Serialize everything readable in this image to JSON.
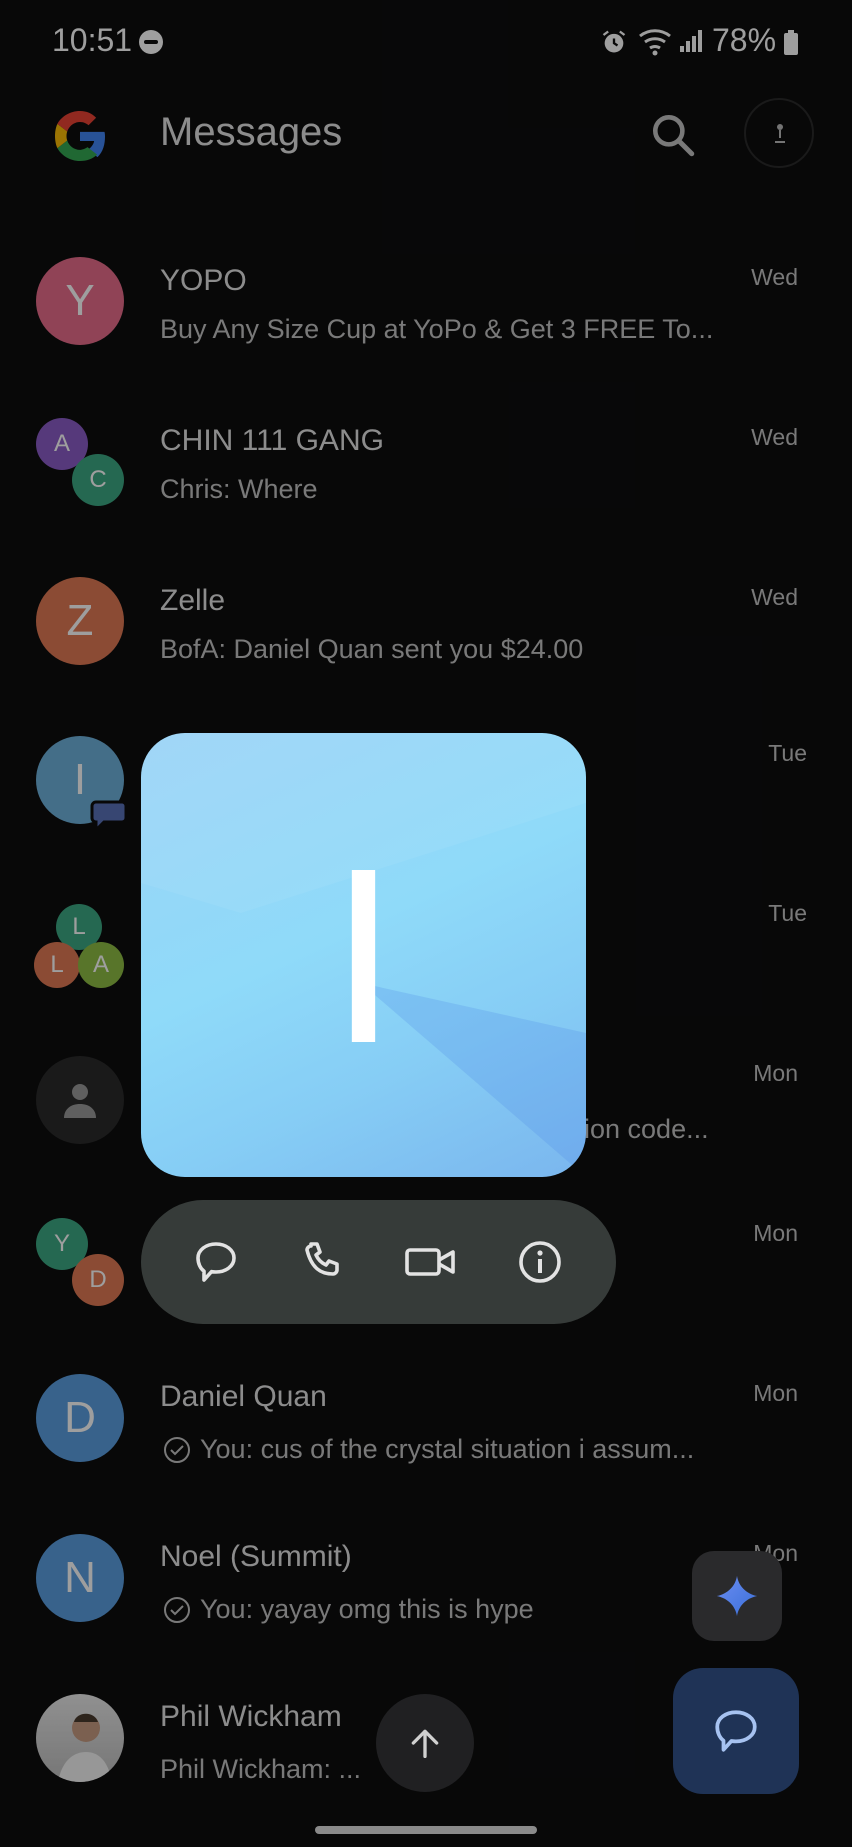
{
  "status_bar": {
    "time": "10:51",
    "battery": "78%"
  },
  "app_bar": {
    "title": "Messages"
  },
  "conversations": [
    {
      "initial": "Y",
      "name": "YOPO",
      "snippet": "Buy Any Size Cup at YoPo & Get 3 FREE To...",
      "date": "Wed",
      "color": "#e86d8c"
    },
    {
      "initials": [
        "A",
        "C"
      ],
      "name": "CHIN 111 GANG",
      "snippet": "Chris: Where",
      "date": "Wed",
      "colors": [
        "#8c5cc7",
        "#3da883"
      ]
    },
    {
      "initial": "Z",
      "name": "Zelle",
      "snippet": "BofA: Daniel Quan sent you $24.00",
      "date": "Wed",
      "color": "#e07a55"
    },
    {
      "initial": "I",
      "name": "",
      "snippet": "",
      "date": "Tue",
      "color": "#6fb2dc"
    },
    {
      "initials": [
        "L",
        "L",
        "A"
      ],
      "name": "",
      "snippet": "",
      "date": "Tue",
      "colors": [
        "#3da883",
        "#e07a55",
        "#8fbd44"
      ]
    },
    {
      "name": "",
      "snippet": "ion code...",
      "date": "Mon",
      "color": "#3a3a3a"
    },
    {
      "initials": [
        "Y",
        "D"
      ],
      "name": "",
      "snippet": "",
      "date": "Mon",
      "colors": [
        "#3da883",
        "#e07a55"
      ]
    },
    {
      "initial": "D",
      "name": "Daniel Quan",
      "snippet": "You: cus of the crystal situation i assum...",
      "date": "Mon",
      "color": "#5b9ee0"
    },
    {
      "initial": "N",
      "name": "Noel (Summit)",
      "snippet": "You: yayay omg this is hype",
      "date": "Mon",
      "color": "#5b9ee0"
    },
    {
      "name": "Phil Wickham",
      "snippet": "Phil Wickham: ...",
      "date": ""
    }
  ],
  "popup": {
    "letter": "I"
  }
}
